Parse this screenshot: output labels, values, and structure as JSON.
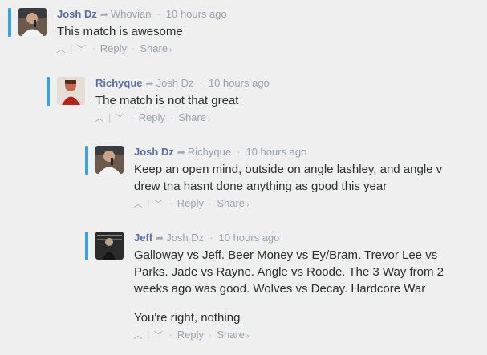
{
  "comments": [
    {
      "author": "Josh Dz",
      "in_reply_to": "Whovian",
      "time": "10 hours ago",
      "body": [
        "This match is awesome"
      ],
      "reply_label": "Reply",
      "share_label": "Share"
    },
    {
      "author": "Richyque",
      "in_reply_to": "Josh Dz",
      "time": "10 hours ago",
      "body": [
        "The match is not that great"
      ],
      "reply_label": "Reply",
      "share_label": "Share"
    },
    {
      "author": "Josh Dz",
      "in_reply_to": "Richyque",
      "time": "10 hours ago",
      "body": [
        "Keep an open mind, outside on angle lashley, and angle v drew tna hasnt done anything as good this year"
      ],
      "reply_label": "Reply",
      "share_label": "Share"
    },
    {
      "author": "Jeff",
      "in_reply_to": "Josh Dz",
      "time": "10 hours ago",
      "body": [
        "Galloway vs Jeff. Beer Money vs Ey/Bram. Trevor Lee vs Parks. Jade vs Rayne. Angle vs Roode. The 3 Way from 2 weeks ago was good. Wolves vs Decay. Hardcore War",
        "You're right, nothing"
      ],
      "reply_label": "Reply",
      "share_label": "Share"
    }
  ],
  "icons": {
    "reply_arrow": "reply-arrow-icon",
    "upvote": "chevron-up-icon",
    "downvote": "chevron-down-icon",
    "share_chevron": "chevron-right-icon"
  },
  "colors": {
    "thread_bar": "#3aa0e6",
    "author": "#5a6fa0",
    "meta": "#9aa3ad",
    "text": "#2a2e2e",
    "background": "#efefef"
  }
}
